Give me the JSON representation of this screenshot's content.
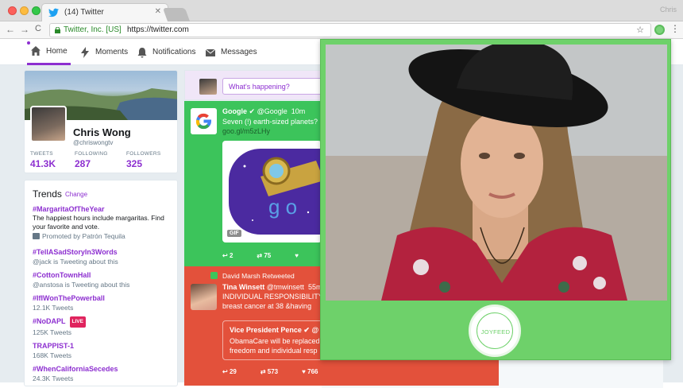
{
  "browser": {
    "tab_title": "(14) Twitter",
    "tab_close": "✕",
    "profile_corner": "Chris",
    "ev_label": "Twitter, Inc. [US]",
    "url": "https://twitter.com",
    "back": "←",
    "forward": "→",
    "reload": "C",
    "star": "☆",
    "menu": "⋮"
  },
  "nav": {
    "home": "Home",
    "moments": "Moments",
    "notifications": "Notifications",
    "messages": "Messages"
  },
  "profile": {
    "name": "Chris Wong",
    "handle": "@chriswongtv",
    "stats": [
      {
        "label": "TWEETS",
        "value": "41.3K"
      },
      {
        "label": "FOLLOWING",
        "value": "287"
      },
      {
        "label": "FOLLOWERS",
        "value": "325"
      }
    ]
  },
  "trends": {
    "title": "Trends",
    "change": "Change",
    "items": [
      {
        "tag": "#MargaritaOfTheYear",
        "desc1": "The happiest hours include margaritas. Find",
        "desc2": "your favorite and vote.",
        "sub": "Promoted by Patrón Tequila"
      },
      {
        "tag": "#TellASadStoryIn3Words",
        "sub": "@jack is Tweeting about this"
      },
      {
        "tag": "#CottonTownHall",
        "sub": "@anstosa is Tweeting about this"
      },
      {
        "tag": "#IfIWonThePowerball",
        "sub": "12.1K Tweets"
      },
      {
        "tag": "#NoDAPL",
        "live": "LIVE",
        "sub": "125K Tweets"
      },
      {
        "tag": "TRAPPIST-1",
        "sub": "168K Tweets"
      },
      {
        "tag": "#WhenCaliforniaSecedes",
        "sub": "24.3K Tweets"
      }
    ]
  },
  "compose": {
    "placeholder": "What's happening?"
  },
  "tweet1": {
    "name": "Google",
    "handle": "@Google",
    "time": "10m",
    "text": "Seven (!) earth-sized planets?",
    "link": "goo.gl/m5zLHy",
    "gif": "GIF",
    "replies": "2",
    "retweets": "75"
  },
  "tweet2": {
    "retweeted_by": "David Marsh Retweeted",
    "name": "Tina Winsett",
    "handle": "@tmwinsett",
    "time": "55m",
    "text1": "INDIVIDUAL RESPONSIBILITY",
    "text2": "breast cancer at 38 &having",
    "quote_name": "Vice President Pence",
    "quote_handle": "@",
    "quote_text1": "ObamaCare will be replaced",
    "quote_text2": "freedom and individual resp",
    "replies": "29",
    "retweets": "573",
    "likes": "766"
  },
  "joyfeed": {
    "logo": "JOYFEED"
  },
  "colors": {
    "accent": "#8d2fd0",
    "popup_green": "#6ed16a",
    "tweet_green": "#3cc45b",
    "tweet_red": "#e3513b"
  }
}
